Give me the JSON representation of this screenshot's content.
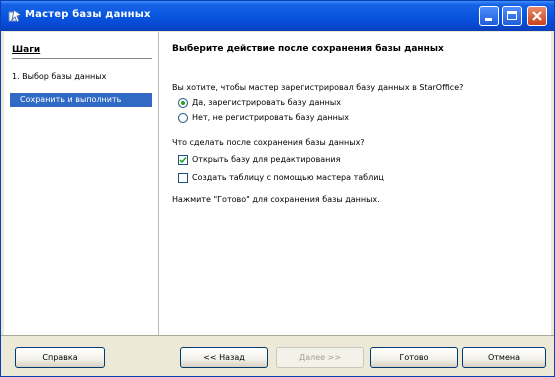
{
  "window": {
    "title": "Мастер базы данных"
  },
  "sidebar": {
    "title": "Шаги",
    "steps": [
      {
        "label": "1. Выбор базы данных"
      },
      {
        "label": "Сохранить и выполнить"
      }
    ]
  },
  "main": {
    "heading": "Выберите действие после сохранения базы данных",
    "register_question": "Вы хотите, чтобы мастер зарегистрировал базу данных в StarOffice?",
    "register_options": [
      {
        "label": "Да, зарегистрировать базу данных",
        "selected": true
      },
      {
        "label": "Нет, не регистрировать базу данных",
        "selected": false
      }
    ],
    "after_question": "Что сделать после сохранения базы данных?",
    "after_options": [
      {
        "label": "Открыть базу для редактирования",
        "checked": true
      },
      {
        "label": "Создать таблицу с помощью мастера таблиц",
        "checked": false
      }
    ],
    "hint": "Нажмите \"Готово\" для сохранения базы данных."
  },
  "buttons": {
    "help": "Справка",
    "back": "<< Назад",
    "next": "Далее >>",
    "finish": "Готово",
    "cancel": "Отмена"
  },
  "colors": {
    "titlebar": "#0a58e0",
    "selection": "#316ac5",
    "face": "#ece9d8"
  }
}
